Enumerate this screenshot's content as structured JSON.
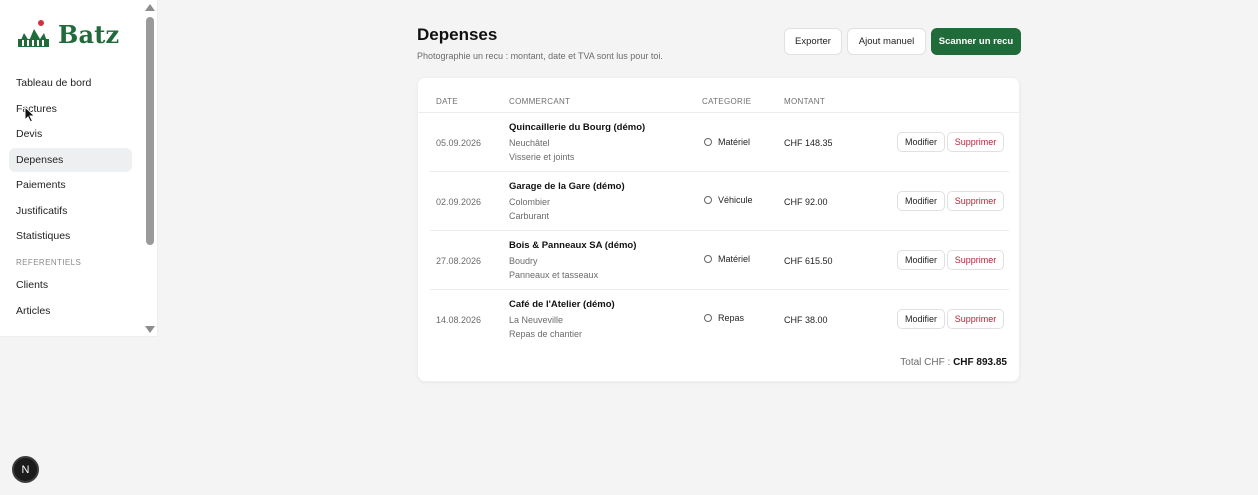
{
  "brand": {
    "name": "Batz",
    "accent": "#1f6b3a",
    "dot": "#d0303a"
  },
  "sidebar": {
    "items": [
      {
        "label": "Tableau de bord",
        "active": false
      },
      {
        "label": "Factures",
        "active": false
      },
      {
        "label": "Devis",
        "active": false
      },
      {
        "label": "Depenses",
        "active": true
      },
      {
        "label": "Paiements",
        "active": false
      },
      {
        "label": "Justificatifs",
        "active": false
      },
      {
        "label": "Statistiques",
        "active": false
      }
    ],
    "section_label": "REFERENTIELS",
    "section_items": [
      {
        "label": "Clients"
      },
      {
        "label": "Articles"
      }
    ]
  },
  "header": {
    "title": "Depenses",
    "subtitle": "Photographie un recu : montant, date et TVA sont lus pour toi.",
    "export_label": "Exporter",
    "manual_label": "Ajout manuel",
    "scan_label": "Scanner un recu"
  },
  "table": {
    "columns": {
      "date": "DATE",
      "merchant": "COMMERCANT",
      "category": "CATEGORIE",
      "amount": "MONTANT"
    },
    "edit_label": "Modifier",
    "delete_label": "Supprimer",
    "rows": [
      {
        "date": "05.09.2026",
        "merchant": "Quincaillerie du Bourg (démo)",
        "city": "Neuchâtel",
        "note": "Visserie et joints",
        "category": "Matériel",
        "amount": "CHF 148.35"
      },
      {
        "date": "02.09.2026",
        "merchant": "Garage de la Gare (démo)",
        "city": "Colombier",
        "note": "Carburant",
        "category": "Véhicule",
        "amount": "CHF 92.00"
      },
      {
        "date": "27.08.2026",
        "merchant": "Bois & Panneaux SA (démo)",
        "city": "Boudry",
        "note": "Panneaux et tasseaux",
        "category": "Matériel",
        "amount": "CHF 615.50"
      },
      {
        "date": "14.08.2026",
        "merchant": "Café de l'Atelier (démo)",
        "city": "La Neuveville",
        "note": "Repas de chantier",
        "category": "Repas",
        "amount": "CHF 38.00"
      }
    ],
    "total_label": "Total CHF :",
    "total_value": "CHF 893.85"
  },
  "dev_badge": {
    "letter": "N"
  }
}
